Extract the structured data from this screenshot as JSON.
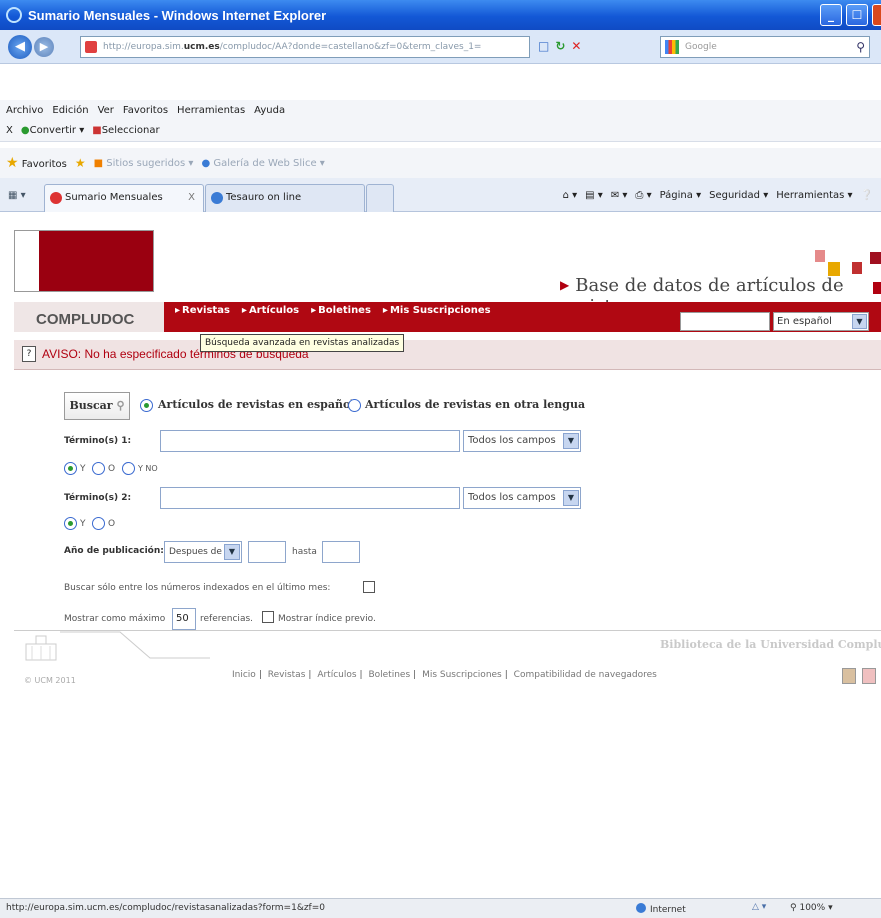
{
  "window": {
    "title": "Sumario Mensuales - Windows Internet Explorer",
    "minimize": "_",
    "maximize": "☐",
    "close": "x"
  },
  "address": {
    "url_prefix": "http://europa.sim.",
    "url_domain": "ucm.es",
    "url_rest": "/compludoc/AA?donde=castellano&zf=0&term_claves_1=",
    "search_placeholder": "Google"
  },
  "menu": [
    "Archivo",
    "Edición",
    "Ver",
    "Favoritos",
    "Herramientas",
    "Ayuda"
  ],
  "convert_bar": {
    "close": "X",
    "convertir": "Convertir",
    "seleccionar": "Seleccionar"
  },
  "favorites_bar": {
    "favoritos": "Favoritos",
    "sitios": "Sitios sugeridos",
    "galeria": "Galería de Web Slice"
  },
  "tabs": [
    {
      "label": "Sumario Mensuales",
      "close": "X"
    },
    {
      "label": "Tesauro on line"
    }
  ],
  "command_bar": [
    "Página",
    "Seguridad",
    "Herramientas"
  ],
  "header": {
    "db_title": "Base de datos de artículos de revistas",
    "brand": "COMPLUDOC",
    "nav": [
      "Revistas",
      "Artículos",
      "Boletines",
      "Mis Suscripciones"
    ],
    "language": "En español",
    "tooltip": "Búsqueda avanzada en revistas analizadas",
    "aviso": "AVISO: No ha especificado términos de búsqueda"
  },
  "form": {
    "buscar": "Buscar",
    "scope_es": "Artículos de revistas en español",
    "scope_other": "Artículos de revistas en otra lengua",
    "term1_label": "Término(s) 1:",
    "term2_label": "Término(s) 2:",
    "field_select": "Todos los campos",
    "op_y": "Y",
    "op_o": "O",
    "op_y_no": "Y NO",
    "year_label": "Año de publicación:",
    "year_mode": "Despues de",
    "hasta": "hasta",
    "only_indexed": "Buscar sólo entre los números indexados en el último mes:",
    "max_prefix": "Mostrar como máximo",
    "max_value": "50",
    "max_suffix": "referencias.",
    "show_index": "Mostrar índice previo."
  },
  "footer": {
    "library": "Biblioteca de la Universidad Complutense",
    "copyright": "© UCM 2011",
    "links": [
      "Inicio",
      "Revistas",
      "Artículos",
      "Boletines",
      "Mis Suscripciones",
      "Compatibilidad de navegadores"
    ]
  },
  "status": {
    "url": "http://europa.sim.ucm.es/compludoc/revistasanalizadas?form=1&zf=0",
    "zone": "Internet",
    "zoom": "100%"
  }
}
